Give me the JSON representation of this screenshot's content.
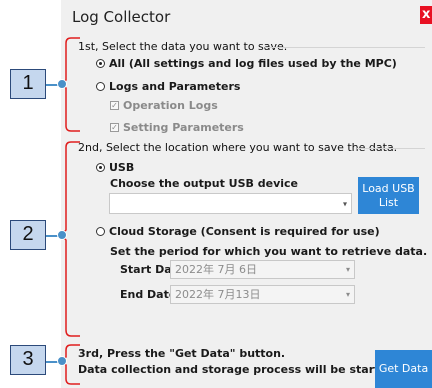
{
  "window": {
    "title": "Log Collector",
    "close_glyph": "x"
  },
  "section1": {
    "heading": "1st, Select the data you want to save.",
    "option_all": "All (All settings and log files used by the MPC)",
    "option_logs": "Logs and Parameters",
    "check_operation": "Operation Logs",
    "check_setting": "Setting Parameters"
  },
  "section2": {
    "heading": "2nd, Select the location where you want to save the data.",
    "usb_label": "USB",
    "usb_choose": "Choose the output USB device",
    "load_usb_button": "Load USB\nList",
    "cloud_label": "Cloud Storage (Consent is required for use)",
    "period_text": "Set the period for which you want to retrieve data.",
    "start_label": "Start Date",
    "start_value": "2022年 7月 6日",
    "end_label": "End Date",
    "end_value": "2022年 7月13日"
  },
  "section3": {
    "line1": "3rd, Press the \"Get Data\" button.",
    "line2": "Data collection and storage process will be started.",
    "get_data_button": "Get Data"
  },
  "callouts": [
    "1",
    "2",
    "3"
  ],
  "colors": {
    "callout_fill": "#c5d7ee",
    "callout_border": "#2c4a7a",
    "bracket": "#e01e1e",
    "button": "#2e86d6",
    "close": "#e81123"
  }
}
